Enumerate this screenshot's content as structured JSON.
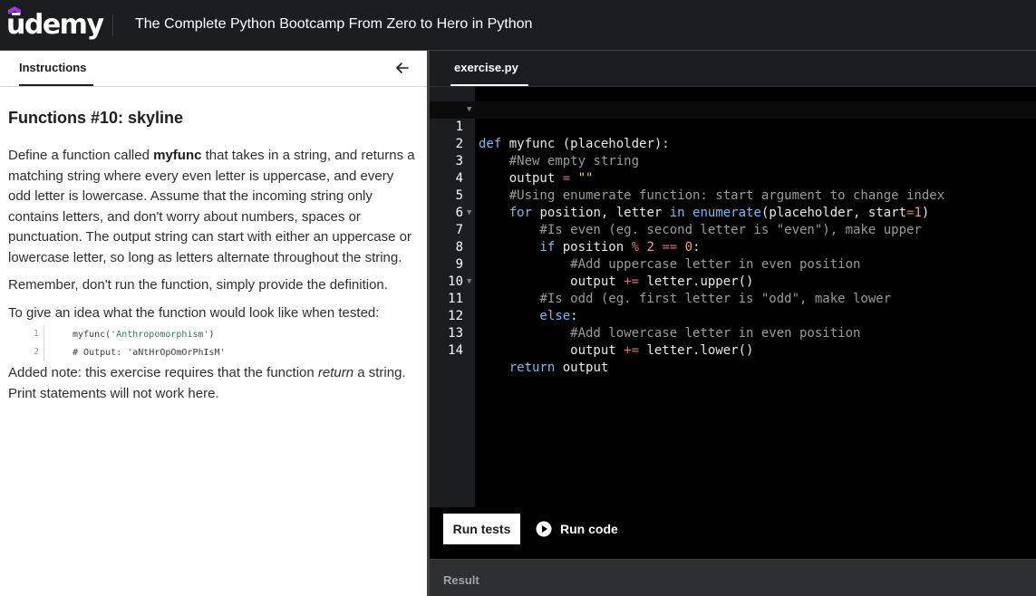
{
  "header": {
    "logo_text": "ūdemy",
    "course_title": "The Complete Python Bootcamp From Zero to Hero in Python"
  },
  "left_panel": {
    "tab_label": "Instructions",
    "title": "Functions #10: skyline",
    "para1_pre": "Define a function called ",
    "para1_bold": "myfunc",
    "para1_post": " that takes in a string, and returns a matching string where every even letter is uppercase, and every odd letter is lowercase. Assume that the incoming string only contains letters, and don't worry about numbers, spaces or punctuation. The output string can start with either an uppercase or lowercase letter, so long as letters alternate throughout the string.",
    "para2": "Remember, don't run the function, simply provide the definition.",
    "para3": "To give an idea what the function would look like when tested:",
    "snippet": [
      {
        "num": "1",
        "pre": "myfunc(",
        "str": "'Anthropomorphism'",
        "post": ")"
      },
      {
        "num": "2",
        "pre": "# Output: 'aNtHrOpOmOrPhIsM'",
        "str": "",
        "post": ""
      }
    ],
    "para4_pre": "Added note: this exercise requires that the function ",
    "para4_em": "return",
    "para4_post": " a string. Print statements will not work here."
  },
  "editor": {
    "file_tab": "exercise.py",
    "lines": [
      {
        "n": "1",
        "fold": true
      },
      {
        "n": "2",
        "fold": false
      },
      {
        "n": "3",
        "fold": false
      },
      {
        "n": "4",
        "fold": false
      },
      {
        "n": "5",
        "fold": false
      },
      {
        "n": "6",
        "fold": false
      },
      {
        "n": "7",
        "fold": true
      },
      {
        "n": "8",
        "fold": false
      },
      {
        "n": "9",
        "fold": false
      },
      {
        "n": "10",
        "fold": false
      },
      {
        "n": "11",
        "fold": true
      },
      {
        "n": "12",
        "fold": false
      },
      {
        "n": "13",
        "fold": false
      },
      {
        "n": "14",
        "fold": false
      }
    ],
    "code": {
      "l1_kw": "def",
      "l1_rest": " myfunc (placeholder):",
      "l2": "    #New empty string",
      "l3_a": "    output ",
      "l3_op": "=",
      "l3_str": " \"\"",
      "l4": "    #Using enumerate function: start argument to change index",
      "l5_for": "    for",
      "l5_a": " position, letter ",
      "l5_in": "in",
      "l5_sp": " ",
      "l5_enum": "enumerate",
      "l5_b": "(placeholder, start",
      "l5_eq": "=",
      "l5_one": "1",
      "l5_c": ")",
      "l6": "        #Is even (eg. second letter is \"even\"), make upper",
      "l7_if": "        if",
      "l7_a": " position ",
      "l7_mod": "%",
      "l7_sp": " ",
      "l7_two": "2",
      "l7_sp2": " ",
      "l7_eqeq": "==",
      "l7_sp3": " ",
      "l7_zero": "0",
      "l7_b": ":",
      "l8": "            #Add uppercase letter in even position",
      "l9_a": "            output ",
      "l9_op": "+=",
      "l9_b": " letter.upper()",
      "l10": "        #Is odd (eg. first letter is \"odd\", make lower",
      "l11_else": "        else",
      "l11_b": ":",
      "l12": "            #Add lowercase letter in even position",
      "l13_a": "            output ",
      "l13_op": "+=",
      "l13_b": " letter.lower()",
      "l14_ret": "    return",
      "l14_b": " output"
    },
    "run_tests_label": "Run tests",
    "run_code_label": "Run code",
    "result_label": "Result"
  }
}
